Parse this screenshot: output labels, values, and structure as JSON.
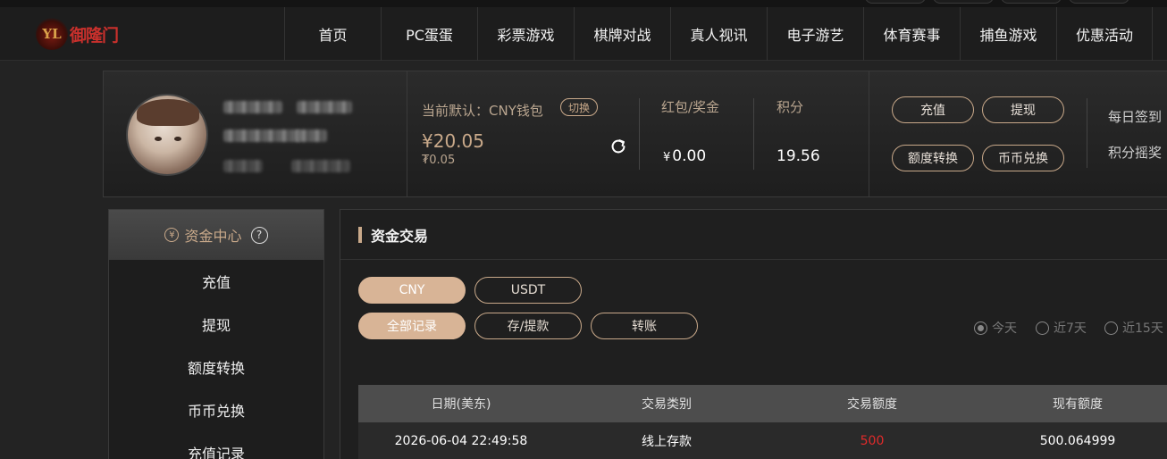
{
  "logo": {
    "mark": "YL",
    "text": "御隆门"
  },
  "nav": {
    "items": [
      "首页",
      "PC蛋蛋",
      "彩票游戏",
      "棋牌对战",
      "真人视讯",
      "电子游艺",
      "体育赛事",
      "捕鱼游戏",
      "优惠活动"
    ]
  },
  "user": {
    "wallet_label": "当前默认：CNY钱包",
    "switch_label": "切换",
    "balance": "¥20.05",
    "balance_sub": "₮0.05",
    "redpacket_label": "红包/奖金",
    "redpacket_currency": "¥",
    "redpacket_value": "0.00",
    "points_label": "积分",
    "points_value": "19.56",
    "actions": {
      "deposit": "充值",
      "withdraw": "提现",
      "transfer": "额度转换",
      "exchange": "币币兑换"
    },
    "daily_checkin": "每日签到",
    "points_lottery": "积分摇奖"
  },
  "sidebar": {
    "title": "资金中心",
    "items": [
      "充值",
      "提现",
      "额度转换",
      "币币兑换",
      "充值记录"
    ]
  },
  "content": {
    "title": "资金交易",
    "currency_tabs": [
      "CNY",
      "USDT"
    ],
    "record_tabs": [
      "全部记录",
      "存/提款",
      "转账"
    ],
    "date_filters": [
      "今天",
      "近7天",
      "近15天"
    ],
    "table": {
      "headers": [
        "日期(美东)",
        "交易类别",
        "交易额度",
        "现有额度"
      ],
      "rows": [
        {
          "date": "2026-06-04 22:49:58",
          "type": "线上存款",
          "amount": "500",
          "balance": "500.064999"
        }
      ]
    }
  },
  "colors": {
    "accent": "#c9a98a",
    "accent_fill": "#d8b496",
    "negative": "#e02a2a"
  }
}
